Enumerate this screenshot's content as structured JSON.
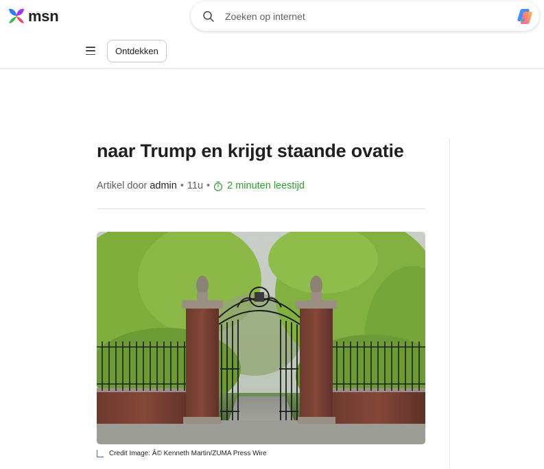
{
  "header": {
    "logo_text": "msn",
    "search": {
      "placeholder": "Zoeken op internet",
      "value": ""
    }
  },
  "subnav": {
    "discover_label": "Ontdekken"
  },
  "article": {
    "title": "naar Trump en krijgt staande ovatie",
    "byline_prefix": "Artikel door",
    "author": "admin",
    "age": "11u",
    "read_time": "2 minuten leestijd",
    "image_caption": "Credit Image: Â© Kenneth Martin/ZUMA Press Wire"
  },
  "colors": {
    "accent_green": "#2e9d2e",
    "caption_mark": "#2f6fb0"
  },
  "icons": [
    "butterfly-logo-icon",
    "search-icon",
    "copilot-icon",
    "hamburger-menu-icon",
    "timer-icon"
  ]
}
